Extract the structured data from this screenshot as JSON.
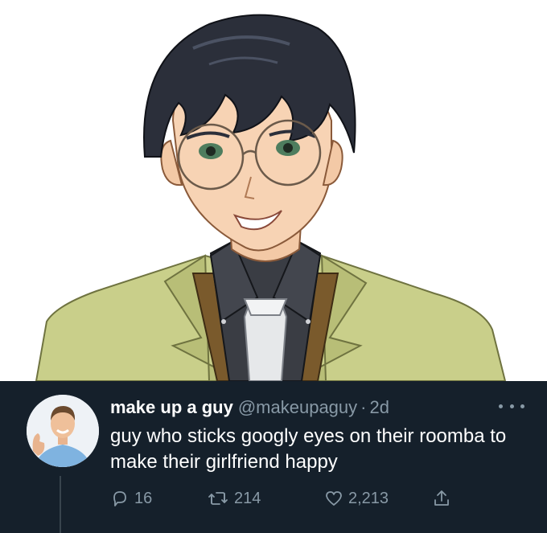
{
  "tweet": {
    "display_name": "make up a guy",
    "handle": "@makeupaguy",
    "separator": "·",
    "time": "2d",
    "text": "guy who sticks googly eyes on their roomba to make their girlfriend happy",
    "replies": "16",
    "retweets": "214",
    "likes": "2,213"
  },
  "icons": {
    "more": "more-horizontal-icon",
    "reply": "reply-icon",
    "retweet": "retweet-icon",
    "like": "heart-icon",
    "share": "share-icon"
  },
  "colors": {
    "background": "#15202b",
    "secondary_text": "#8899a6",
    "thread_line": "#38444d",
    "jacket": "#c9cf8a",
    "hair": "#2b2f3a"
  }
}
